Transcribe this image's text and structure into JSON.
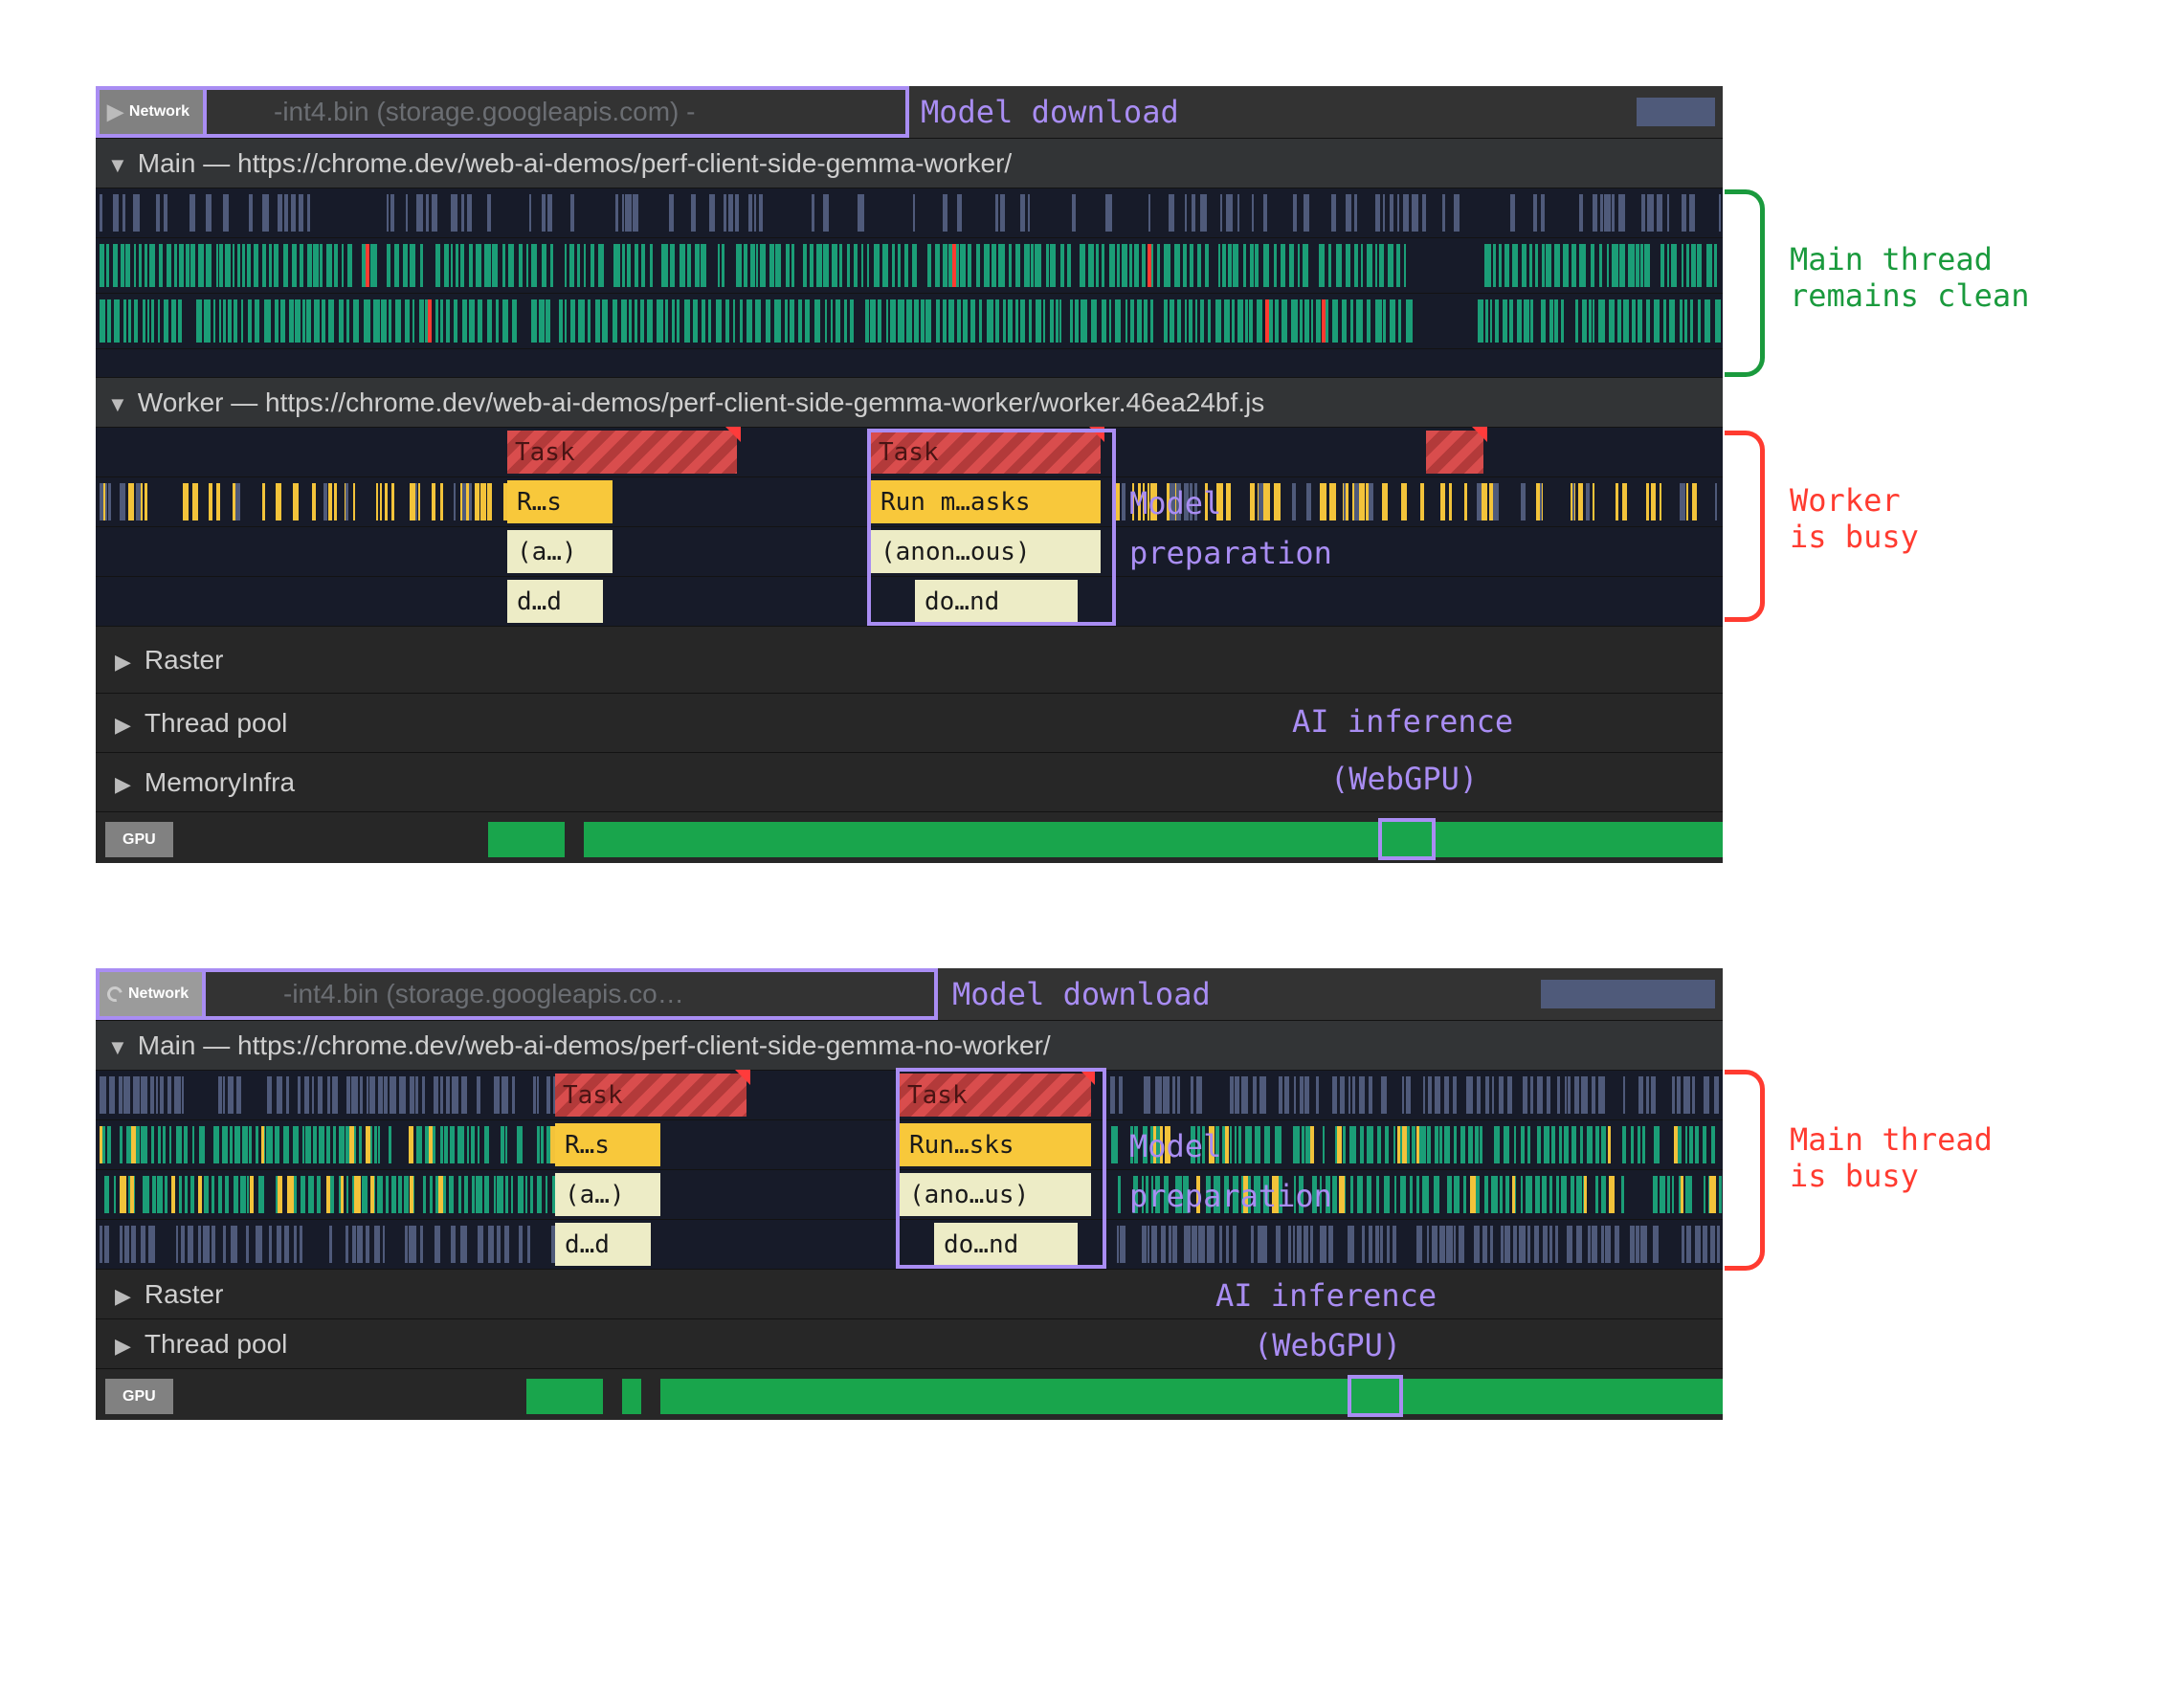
{
  "panel1": {
    "network": {
      "label": "Network",
      "file": "-int4.bin (storage.googleapis.com) -",
      "anno": "Model download"
    },
    "main_header": "Main — https://chrome.dev/web-ai-demos/perf-client-side-gemma-worker/",
    "worker_header": "Worker — https://chrome.dev/web-ai-demos/perf-client-side-gemma-worker/worker.46ea24bf.js",
    "task": "Task",
    "slabs": {
      "rs": "R…s",
      "rm": "Run m…asks",
      "a": "(a…)",
      "an": "(anon…ous)",
      "dd": "d…d",
      "dn": "do…nd"
    },
    "anno_modelprep1": "Model",
    "anno_modelprep2": "preparation",
    "sections": {
      "raster": "Raster",
      "threadpool": "Thread pool",
      "memoryinfra": "MemoryInfra",
      "gpu": "GPU"
    },
    "anno_ai1": "AI inference",
    "anno_ai2": "(WebGPU)",
    "side1": "Main thread",
    "side1b": "remains clean",
    "side2": "Worker",
    "side2b": "is busy"
  },
  "panel2": {
    "network": {
      "label": "Network",
      "file": "-int4.bin (storage.googleapis.co…",
      "anno": "Model download"
    },
    "main_header": "Main — https://chrome.dev/web-ai-demos/perf-client-side-gemma-no-worker/",
    "task": "Task",
    "slabs": {
      "rs": "R…s",
      "rsk": "Run…sks",
      "a": "(a…)",
      "an": "(ano…us)",
      "dd": "d…d",
      "dn": "do…nd"
    },
    "anno_modelprep1": "Model",
    "anno_modelprep2": "preparation",
    "sections": {
      "raster": "Raster",
      "threadpool": "Thread pool",
      "gpu": "GPU"
    },
    "anno_ai1": "AI inference",
    "anno_ai2": "(WebGPU)",
    "side1": "Main thread",
    "side1b": "is busy"
  }
}
